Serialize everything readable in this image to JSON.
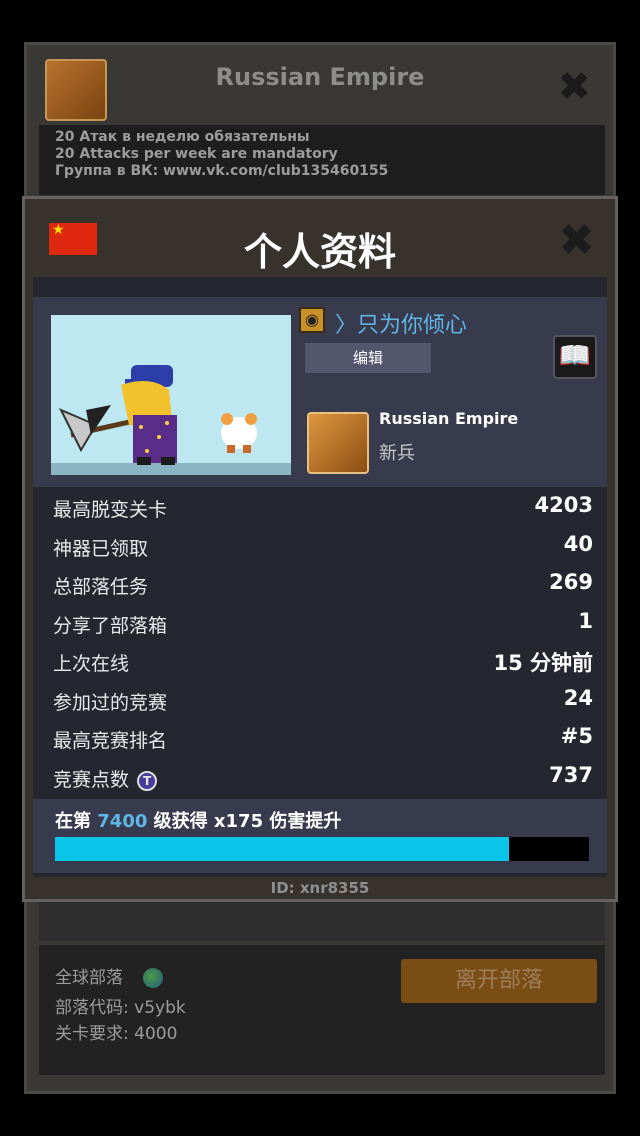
{
  "background": {
    "clan_title": "Russian Empire",
    "description": [
      "20 Атак в неделю обязательны",
      "20 Attacks per week are mandatory",
      "Группа в ВК: www.vk.com/club135460155"
    ],
    "global_label": "全球部落",
    "clan_code": "部落代码: v5ybk",
    "level_requirement": "关卡要求:  4000",
    "leave_button": "离开部落"
  },
  "dialog": {
    "title": "个人资料",
    "flag": "china-flag",
    "player_name": "〉只为你倾心",
    "edit_label": "编辑",
    "clan_name": "Russian Empire",
    "clan_rank": "新兵",
    "stats": [
      {
        "label": "最高脱变关卡",
        "value": "4203"
      },
      {
        "label": "神器已领取",
        "value": "40"
      },
      {
        "label": "总部落任务",
        "value": "269"
      },
      {
        "label": "分享了部落箱",
        "value": "1"
      },
      {
        "label": "上次在线",
        "value": "15 分钟前"
      },
      {
        "label": "参加过的竞赛",
        "value": "24"
      },
      {
        "label": "最高竞赛排名",
        "value": "#5"
      },
      {
        "label": "竞赛点数",
        "value": "737"
      }
    ],
    "progress": {
      "prefix": "在第 ",
      "level": "7400",
      "suffix": " 级获得 x175 伤害提升",
      "fill_fraction": 0.85
    },
    "player_id": "ID: xnr8355"
  },
  "colors": {
    "accent_blue": "#5fb5e6",
    "progress_fill": "#0bc5e8",
    "flag_red": "#de2910"
  }
}
